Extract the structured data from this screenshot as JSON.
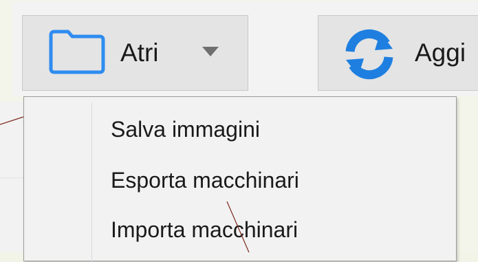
{
  "toolbar": {
    "atri_button": {
      "label": "Atri",
      "icon": "folder-icon",
      "dropdown_icon": "caret-down-icon"
    },
    "aggiorna_button": {
      "label": "Aggi",
      "icon": "refresh-icon"
    }
  },
  "menu": {
    "items": [
      {
        "label": "Salva immagini"
      },
      {
        "label": "Esporta macchinari"
      },
      {
        "label": "Importa macchinari"
      }
    ]
  },
  "colors": {
    "folder_icon": "#2f8cf0",
    "refresh_icon": "#1e7fe0",
    "annotation_line": "#7a2a1e"
  }
}
